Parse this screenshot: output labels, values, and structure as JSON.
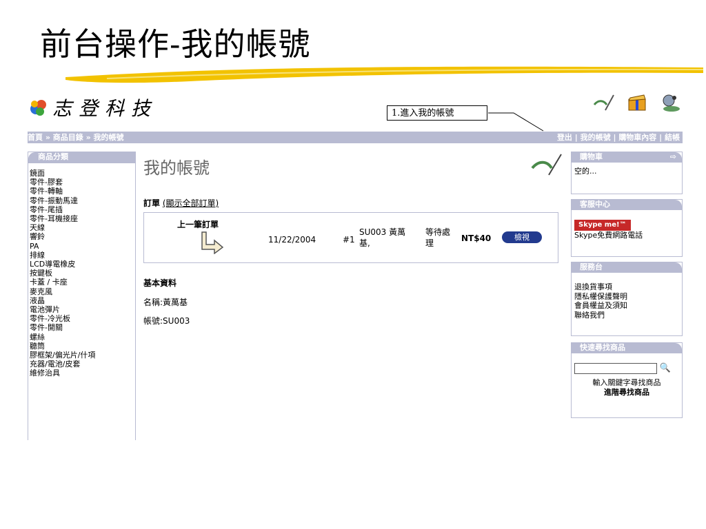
{
  "slide": {
    "title": "前台操作-我的帳號"
  },
  "site": {
    "logo_text": "志登科技",
    "callout": "1.進入我的帳號",
    "breadcrumb": "首頁 » 商品目錄 » 我的帳號",
    "nav_right": [
      "登出",
      "我的帳號",
      "購物車內容",
      "結帳"
    ]
  },
  "sidebar": {
    "heading": "商品分類",
    "items": [
      "鏡面",
      "零件-膠套",
      "零件-轉軸",
      "零件-振動馬達",
      "零件-尾插",
      "零件-耳機接座",
      "天線",
      "響鈴",
      "PA",
      "排線",
      "LCD導電橡皮",
      "按鍵板",
      "卡蓋 / 卡座",
      "麥克風",
      "液晶",
      "電池彈片",
      "零件-冷光板",
      "零件-開關",
      "螺絲",
      "聽筒",
      "膠框架/偏光片/什項",
      "充器/電池/皮套",
      "維修治具"
    ]
  },
  "main": {
    "title": "我的帳號",
    "orders_label": "訂單",
    "show_all_link": "(顯示全部訂單)",
    "prev_order_label": "上一筆訂單",
    "order": {
      "date": "11/22/2004",
      "number": "#1",
      "account_line1": "SU003 黃萬",
      "account_line2": "基,",
      "status_line1": "等待處",
      "status_line2": "理",
      "amount": "NT$40",
      "view_button": "檢視"
    },
    "basic_title": "基本資料",
    "name_row": "名稱:黃萬基",
    "account_row": "帳號:SU003"
  },
  "right": {
    "cart_heading": "購物車",
    "cart_text": "空的...",
    "service_heading": "客服中心",
    "skype_badge": "Skype me!™",
    "skype_text": "Skype免費網路電話",
    "bulletin_heading": "服務台",
    "bulletin_items": [
      "退換貨事項",
      "隱私權保護聲明",
      "會員權益及須知",
      "聯絡我們"
    ],
    "search_heading": "快速尋找商品",
    "search_hint": "輸入關鍵字尋找商品",
    "advanced_search": "進階尋找商品"
  },
  "colors": {
    "nav_bar": "#b8bbd2",
    "button": "#223a8e",
    "brush": "#f2c200"
  }
}
